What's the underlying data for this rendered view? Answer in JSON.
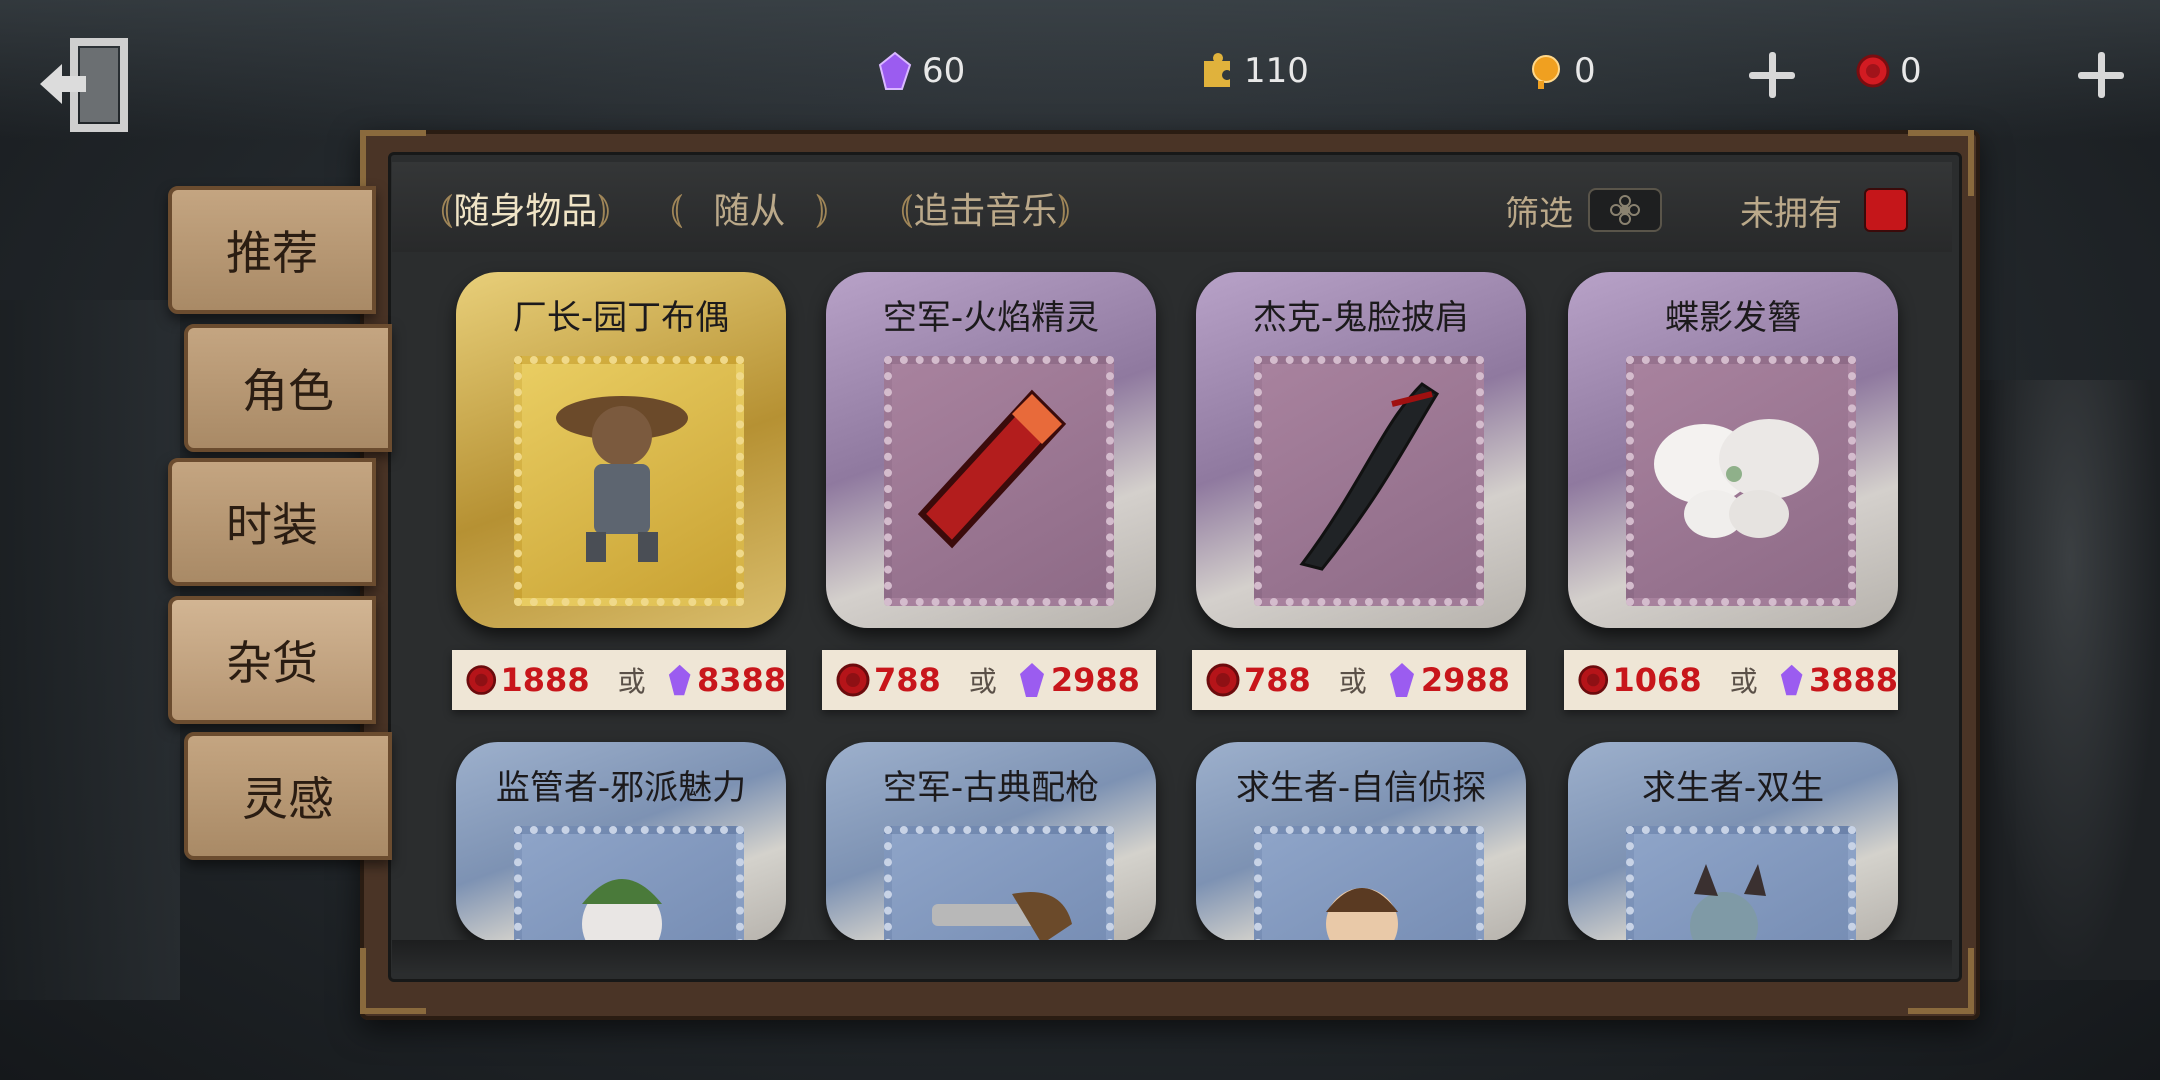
{
  "currencies": [
    {
      "name": "gem-icon",
      "value": "60",
      "color": "#b06cff"
    },
    {
      "name": "puzzle-icon",
      "value": "110",
      "color": "#e0b23c"
    },
    {
      "name": "clue-icon",
      "value": "0",
      "color": "#f0a020"
    },
    {
      "name": "seal-icon",
      "value": "0",
      "color": "#d21b22"
    }
  ],
  "tabs": [
    {
      "label": "随身物品",
      "active": true
    },
    {
      "label": "随从",
      "active": false
    },
    {
      "label": "追击音乐",
      "active": false
    }
  ],
  "filter": {
    "label": "筛选"
  },
  "owned_filter": {
    "label": "未拥有"
  },
  "side_menu": [
    {
      "label": "推荐"
    },
    {
      "label": "角色"
    },
    {
      "label": "时装"
    },
    {
      "label": "杂货",
      "active": true
    },
    {
      "label": "灵感"
    }
  ],
  "items": [
    {
      "name": "厂长-园丁布偶",
      "price_seal": "1888",
      "or": "或",
      "price_gem": "8388",
      "style": "gold"
    },
    {
      "name": "空军-火焰精灵",
      "price_seal": "788",
      "or": "或",
      "price_gem": "2988",
      "style": "purple"
    },
    {
      "name": "杰克-鬼脸披肩",
      "price_seal": "788",
      "or": "或",
      "price_gem": "2988",
      "style": "purple"
    },
    {
      "name": "蝶影发簪",
      "price_seal": "1068",
      "or": "或",
      "price_gem": "3888",
      "style": "purple"
    },
    {
      "name": "监管者-邪派魅力",
      "style": "blue"
    },
    {
      "name": "空军-古典配枪",
      "style": "blue"
    },
    {
      "name": "求生者-自信侦探",
      "style": "blue"
    },
    {
      "name": "求生者-双生",
      "style": "blue"
    }
  ],
  "colors": {
    "seal_red": "#c8161b",
    "gem_purple": "#9b5cf0",
    "board_wood": "#4a3426"
  }
}
